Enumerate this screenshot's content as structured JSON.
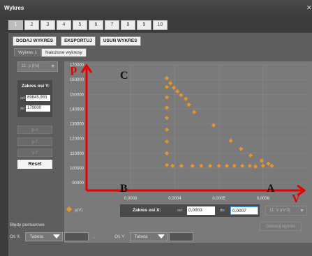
{
  "window": {
    "title": "Wykres",
    "close_icon": "close-icon"
  },
  "number_tabs": [
    "1",
    "2",
    "3",
    "4",
    "5",
    "6",
    "7",
    "8",
    "9",
    "10"
  ],
  "toolbar": {
    "add": "DODAJ WYKRES",
    "export": "EKSPORTUJ",
    "delete": "USUŃ WYKRES"
  },
  "subtabs": [
    "Wykres 1",
    "Nałożone wykresy"
  ],
  "left": {
    "y_select": "11: p [Pa]",
    "zakres_y_title": "Zakres osi Y:",
    "od_label": "od:",
    "do_label": "do:",
    "y_from": "89845,983",
    "y_to": "170000",
    "btn_pv": "p-V",
    "btn_pt": "p-T",
    "btn_vt": "V-T",
    "reset": "Reset"
  },
  "axis_labels": {
    "p": "p",
    "v": "V"
  },
  "point_labels": {
    "a": "A",
    "b": "B",
    "c": "C"
  },
  "chart_data": {
    "type": "scatter",
    "ylim": [
      90000,
      170000
    ],
    "xlim": [
      0.0002,
      0.0007
    ],
    "y_ticks": [
      "170000",
      "160000",
      "150000",
      "140000",
      "130000",
      "120000",
      "110000",
      "100000",
      "90000"
    ],
    "x_ticks": [
      "0,0003",
      "0,0004",
      "0,0005",
      "0,0006"
    ],
    "series": [
      {
        "name": "p(V)",
        "points": [
          [
            0.000382,
            102000
          ],
          [
            0.000395,
            101500
          ],
          [
            0.000415,
            101500
          ],
          [
            0.00044,
            101500
          ],
          [
            0.00046,
            101500
          ],
          [
            0.00048,
            101500
          ],
          [
            0.0005,
            101500
          ],
          [
            0.000518,
            101500
          ],
          [
            0.000535,
            101500
          ],
          [
            0.000553,
            101500
          ],
          [
            0.00057,
            101500
          ],
          [
            0.000583,
            101000
          ],
          [
            0.0006,
            101500
          ],
          [
            0.000612,
            103000
          ],
          [
            0.00062,
            101500
          ],
          [
            0.000382,
            110000
          ],
          [
            0.000382,
            118000
          ],
          [
            0.000382,
            126000
          ],
          [
            0.000382,
            134000
          ],
          [
            0.000382,
            141000
          ],
          [
            0.000382,
            148000
          ],
          [
            0.000382,
            155000
          ],
          [
            0.000382,
            161000
          ],
          [
            0.00039,
            157500
          ],
          [
            0.000398,
            154500
          ],
          [
            0.000406,
            152000
          ],
          [
            0.000414,
            149500
          ],
          [
            0.000425,
            147000
          ],
          [
            0.000432,
            143000
          ],
          [
            0.000444,
            138000
          ],
          [
            0.000488,
            129000
          ],
          [
            0.000527,
            118500
          ],
          [
            0.00055,
            113000
          ],
          [
            0.000572,
            108500
          ],
          [
            0.000597,
            105000
          ]
        ]
      }
    ]
  },
  "legend": {
    "series": "p(V)"
  },
  "x_range": {
    "title": "Zakres osi X:",
    "od": "od:",
    "do": "do:",
    "from": "0,0003",
    "to": "0,0007"
  },
  "x_select": "11: V [m^3]",
  "generate": "Generuj wykres",
  "errors": {
    "title": "Błędy pomiarowe",
    "os_x": "Oś X",
    "os_y": "Oś Y",
    "tabela_x": "Tabela",
    "tabela_y": "Tabela",
    "comma": ","
  },
  "colors": {
    "point": "#e8932c",
    "axis": "#e60000",
    "grid": "#8a8a8a",
    "plot_bg": "#7a7a7a"
  }
}
